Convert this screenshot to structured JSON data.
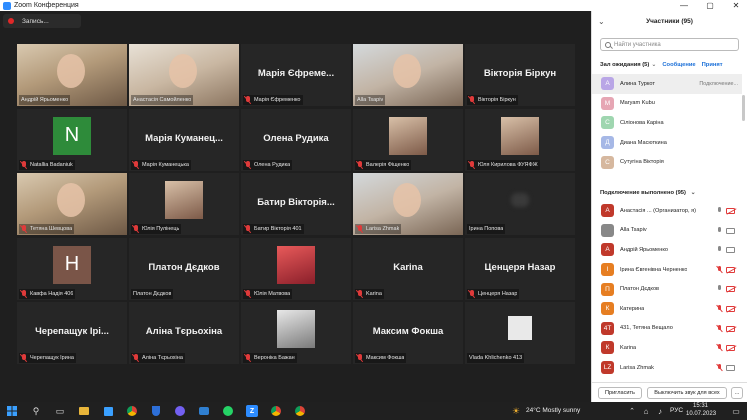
{
  "window": {
    "title": "Zoom Конференция",
    "minimize": "—",
    "restore": "▢",
    "close": "✕"
  },
  "recording": {
    "label": "Запись..."
  },
  "tiles": [
    {
      "label": "Андрій Ярьоменко",
      "type": "video",
      "active": true,
      "muted": false
    },
    {
      "label": "Анастасія Самойленко",
      "type": "video",
      "muted": false
    },
    {
      "label": "Марія Єфременко",
      "type": "name",
      "big": "Марія Єфреме...",
      "muted": true
    },
    {
      "label": "Alla Tsapiv",
      "type": "video",
      "muted": false
    },
    {
      "label": "Вікторія Біркун",
      "type": "name",
      "big": "Вікторія Біркун",
      "muted": true
    },
    {
      "label": "Natallia Badaniuk",
      "type": "avatar",
      "letter": "N",
      "color": "#2e8b3a",
      "muted": true
    },
    {
      "label": "Марія Куманецька",
      "type": "name",
      "big": "Марія Куманец...",
      "muted": true
    },
    {
      "label": "Олена Рудика",
      "type": "name",
      "big": "Олена Рудика",
      "muted": true
    },
    {
      "label": "Валерія Фіщенко",
      "type": "photo",
      "muted": true
    },
    {
      "label": "Юля Кирилова ФУЯФЖ",
      "type": "photo",
      "muted": true
    },
    {
      "label": "Тетяна Шевцова",
      "type": "video",
      "muted": true
    },
    {
      "label": "Юлія Пулінець",
      "type": "photo",
      "muted": true
    },
    {
      "label": "Батир Вікторія 401",
      "type": "name",
      "big": "Батир Вікторія...",
      "muted": true
    },
    {
      "label": "Larisa Zhmak",
      "type": "video",
      "muted": true
    },
    {
      "label": "Ірина Попова",
      "type": "blur",
      "muted": false
    },
    {
      "label": "Кавфа Надія 406",
      "type": "avatar",
      "letter": "Н",
      "color": "#7a5548",
      "muted": true
    },
    {
      "label": "Платон Дєдков",
      "type": "name",
      "big": "Платон Дєдков",
      "muted": false
    },
    {
      "label": "Юлія Матвова",
      "type": "photo",
      "muted": true
    },
    {
      "label": "Karina",
      "type": "name",
      "big": "Karina",
      "muted": true
    },
    {
      "label": "Ценцеря Назар",
      "type": "name",
      "big": "Ценцеря Назар",
      "muted": true
    },
    {
      "label": "Черепащук Ірина",
      "type": "name",
      "big": "Черепащук Ірі...",
      "muted": true
    },
    {
      "label": "Аліна Тєрьохіна",
      "type": "name",
      "big": "Аліна Тєрьохіна",
      "muted": true
    },
    {
      "label": "Вероніка Бажан",
      "type": "photo",
      "muted": true
    },
    {
      "label": "Максим Фокша",
      "type": "name",
      "big": "Максим Фокша",
      "muted": true
    },
    {
      "label": "Vlada Khlichenko 413",
      "type": "photo",
      "muted": false
    }
  ],
  "panel": {
    "title": "Участники (95)",
    "search_placeholder": "Найти участника",
    "waiting_title": "Зал ожидания (5)",
    "message_link": "Сообщение",
    "admit_link": "Принят",
    "waiting": [
      {
        "letter": "А",
        "name": "Алина Туркот",
        "color": "#b9a6e6",
        "extra": "Подключение..."
      },
      {
        "letter": "М",
        "name": "Maryam Kubu",
        "color": "#e6a6b4",
        "extra": ""
      },
      {
        "letter": "С",
        "name": "Сіліонова Каріна",
        "color": "#9fd6b0",
        "extra": ""
      },
      {
        "letter": "Д",
        "name": "Диана Масюткина",
        "color": "#a6b8e6",
        "extra": ""
      },
      {
        "letter": "С",
        "name": "Сутугіна Вікторія",
        "color": "#d6b89f",
        "extra": ""
      }
    ],
    "connected_title": "Подключение выполнено (95)",
    "connected": [
      {
        "letter": "А",
        "name": "Анастасія ... (Организатор, я)",
        "color": "#c0392b",
        "mic": "on",
        "cam": "off"
      },
      {
        "letter": "",
        "name": "Alla Tsapiv",
        "color": "#888888",
        "mic": "on",
        "cam": "on"
      },
      {
        "letter": "А",
        "name": "Андрій Ярьоменко",
        "color": "#c0392b",
        "mic": "on",
        "cam": "on"
      },
      {
        "letter": "І",
        "name": "Ірина Євгенівна Черненко",
        "color": "#e67e22",
        "mic": "off",
        "cam": "off"
      },
      {
        "letter": "П",
        "name": "Платон Дєдков",
        "color": "#e67e22",
        "mic": "on",
        "cam": "off"
      },
      {
        "letter": "К",
        "name": "Катерина",
        "color": "#e67e22",
        "mic": "off",
        "cam": "off"
      },
      {
        "letter": "4Т",
        "name": "431, Тетяна Вещало",
        "color": "#c0392b",
        "mic": "off",
        "cam": "off"
      },
      {
        "letter": "К",
        "name": "Karina",
        "color": "#c0392b",
        "mic": "off",
        "cam": "off"
      },
      {
        "letter": "LZ",
        "name": "Larisa Zhmak",
        "color": "#c0392b",
        "mic": "off",
        "cam": "on"
      }
    ],
    "invite_label": "Пригласить",
    "mute_all_label": "Выключить звук для всех",
    "more_label": "..."
  },
  "taskbar": {
    "weather": "24°C  Mostly sunny",
    "lang": "РУС",
    "time": "15:31",
    "date": "10.07.2023"
  }
}
